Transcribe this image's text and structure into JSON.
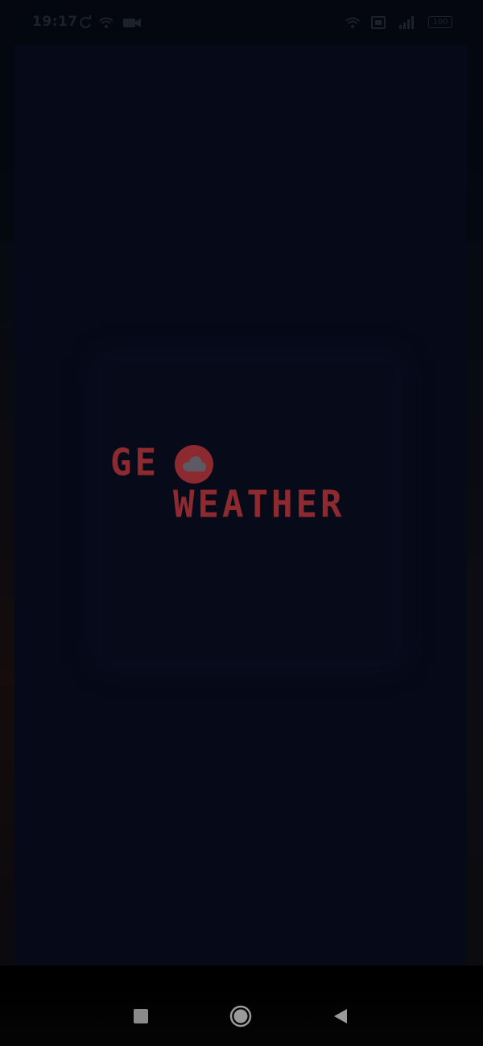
{
  "status_bar": {
    "time": "19:17",
    "icons": [
      "sync-icon",
      "wifi-icon",
      "camera-icon",
      "wifi-icon",
      "screen-icon",
      "cellular-signal-icon"
    ],
    "battery": "100"
  },
  "splash": {
    "logo_line1": "GE",
    "logo_line2": "WEATHER",
    "logo_icon": "cloud-icon"
  },
  "colors": {
    "background": "#060a18",
    "logo": "#8c2a30",
    "logo_cloud": "#5d5a63",
    "status_bar_text": "#1d212b"
  },
  "nav_bar": {
    "buttons": [
      "recents-button",
      "home-button",
      "back-button"
    ]
  }
}
